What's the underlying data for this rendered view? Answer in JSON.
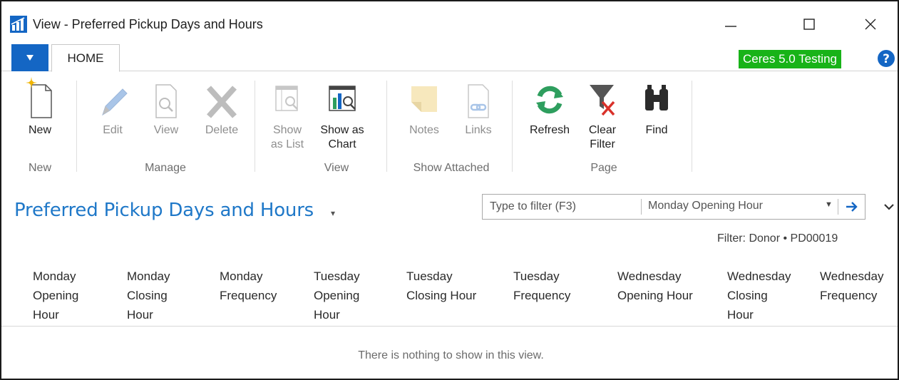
{
  "window": {
    "title": "View - Preferred Pickup Days and Hours",
    "controls": {
      "minimize": "minimize",
      "maximize": "maximize",
      "close": "close"
    }
  },
  "ribbon_tabs": {
    "app_menu_icon": "triangle-down-icon",
    "home": "HOME",
    "environment": "Ceres 5.0 Testing",
    "help_icon": "help-icon"
  },
  "ribbon": {
    "buttons": {
      "new": "New",
      "edit": "Edit",
      "view": "View",
      "delete": "Delete",
      "show_as_list_1": "Show",
      "show_as_list_2": "as List",
      "show_as_chart_1": "Show as",
      "show_as_chart_2": "Chart",
      "notes": "Notes",
      "links": "Links",
      "refresh": "Refresh",
      "clear_filter_1": "Clear",
      "clear_filter_2": "Filter",
      "find": "Find"
    },
    "groups": {
      "new": "New",
      "manage": "Manage",
      "view": "View",
      "show_attached": "Show Attached",
      "page": "Page"
    }
  },
  "page": {
    "title": "Preferred Pickup Days and Hours",
    "filter_placeholder": "Type to filter (F3)",
    "filter_field": "Monday Opening Hour",
    "filter_status": "Filter: Donor • PD00019",
    "empty_message": "There is nothing to show in this view."
  },
  "columns": [
    {
      "l1": "Monday",
      "l2": "Opening",
      "l3": "Hour"
    },
    {
      "l1": "Monday",
      "l2": "Closing",
      "l3": "Hour"
    },
    {
      "l1": "Monday",
      "l2": "Frequency",
      "l3": ""
    },
    {
      "l1": "Tuesday",
      "l2": "Opening",
      "l3": "Hour"
    },
    {
      "l1": "Tuesday",
      "l2": "Closing Hour",
      "l3": ""
    },
    {
      "l1": "Tuesday",
      "l2": "Frequency",
      "l3": ""
    },
    {
      "l1": "Wednesday",
      "l2": "Opening Hour",
      "l3": ""
    },
    {
      "l1": "Wednesday",
      "l2": "Closing",
      "l3": "Hour"
    },
    {
      "l1": "Wednesday",
      "l2": "Frequency",
      "l3": ""
    }
  ],
  "colors": {
    "accent_blue": "#1466c4",
    "title_blue": "#1f78c8",
    "env_green": "#18b318",
    "refresh_green": "#2e9e5e",
    "clear_filter_red": "#d9312a"
  }
}
